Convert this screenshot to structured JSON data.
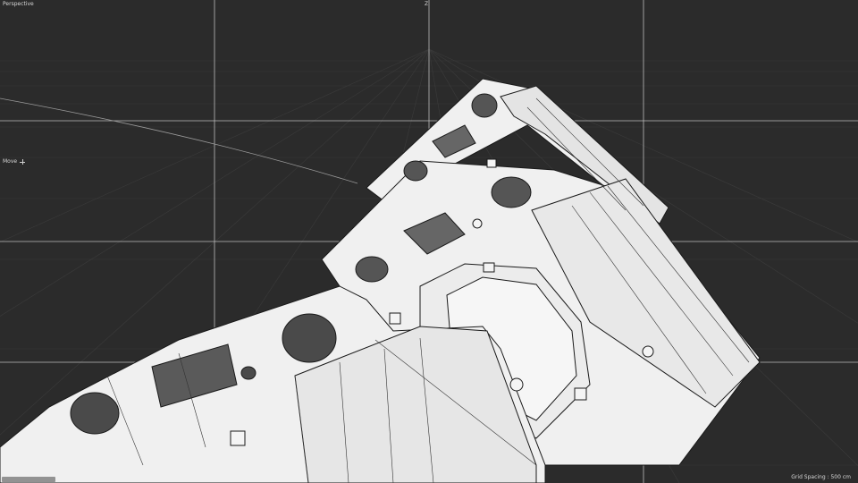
{
  "viewport": {
    "view_name": "Perspective",
    "axis_indicator": "Z",
    "tool_name": "Move",
    "tool_icon": "move-crosshair-icon",
    "grid_spacing_label": "Grid Spacing : 500 cm"
  },
  "colors": {
    "background": "#2b2b2b",
    "grid_line": "#3a3a3a",
    "guide_line": "#c8c8c8",
    "model_fill": "#f2f2f2",
    "model_edge": "#1a1a1a"
  },
  "model": {
    "description_icon": "robot-arm-mesh-icon"
  }
}
